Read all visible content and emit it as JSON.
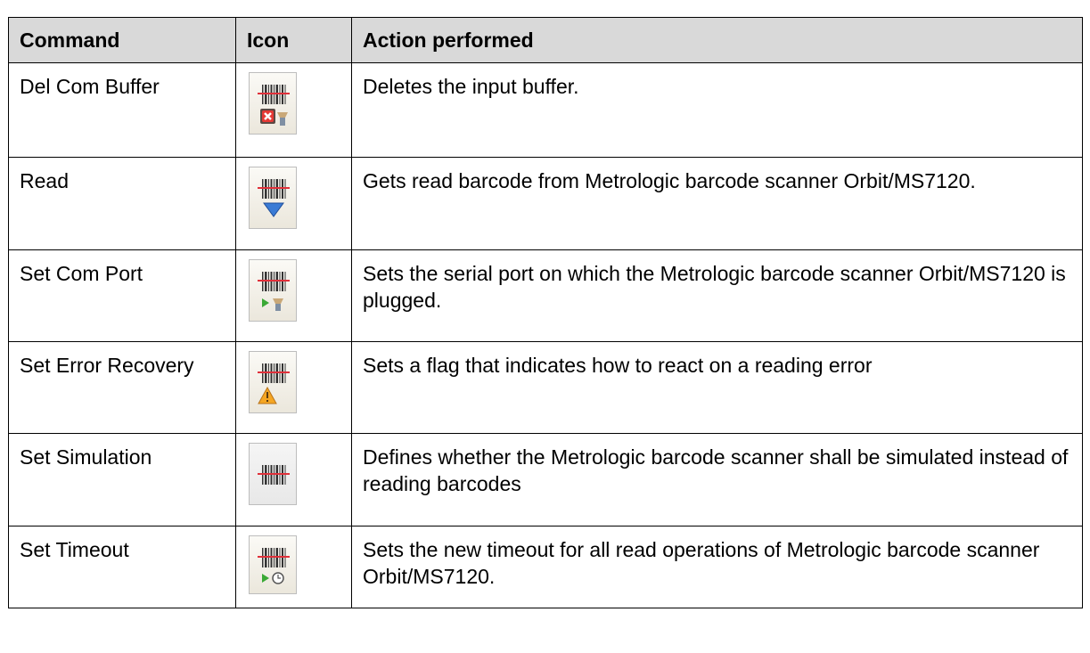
{
  "headers": {
    "command": "Command",
    "icon": "Icon",
    "action": "Action performed"
  },
  "rows": [
    {
      "command": "Del Com Buffer",
      "icon": "barcode-delete-buffer-icon",
      "action": "Deletes the input buffer."
    },
    {
      "command": "Read",
      "icon": "barcode-read-icon",
      "action": "Gets read barcode from Metrologic barcode scanner Orbit/MS7120."
    },
    {
      "command": "Set Com Port",
      "icon": "barcode-com-port-icon",
      "action": "Sets the serial port on which the Metrologic barcode scanner Orbit/MS7120 is plugged."
    },
    {
      "command": "Set Error Recovery",
      "icon": "barcode-error-warning-icon",
      "action": "Sets a flag that indicates how to react on a reading error"
    },
    {
      "command": "Set Simulation",
      "icon": "barcode-simulation-icon",
      "action": "Defines whether the Metrologic barcode scanner shall be simulated instead of reading barcodes"
    },
    {
      "command": "Set Timeout",
      "icon": "barcode-timeout-icon",
      "action": "Sets the new timeout for all read operations of Metrologic barcode scanner Orbit/MS7120."
    }
  ],
  "colors": {
    "header_bg": "#d9d9d9",
    "scan_line": "#e0303a",
    "border": "#000000"
  }
}
